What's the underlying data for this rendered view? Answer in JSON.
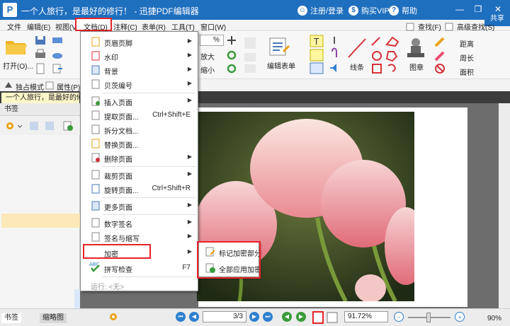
{
  "title": {
    "tagline": "一个人旅行，是最好的修行！",
    "sep": "-",
    "app": "迅捷PDF编辑器",
    "login": "注册/登录",
    "vip": "购买VIP",
    "help": "帮助",
    "logo": "P"
  },
  "menubar": {
    "items": [
      "文件",
      "编辑(E)",
      "视图(V)",
      "文档(D)",
      "注释(C)",
      "表单(R)",
      "工具(T)",
      "窗口(W)"
    ],
    "right_tab": "共享"
  },
  "toolbar": {
    "open": "打开(O)...",
    "zoom_value": "%",
    "zoom_in": "放大",
    "zoom_out": "缩小",
    "edit_form": "编辑表单",
    "lines": "线条",
    "stamp": "图章",
    "find": "查找(F)",
    "adv_find": "高级查找(S)",
    "distance": "距离",
    "perimeter": "周长",
    "area": "面积"
  },
  "subbar": {
    "exclusive": "独占模式",
    "properties": "属性(P)..."
  },
  "doc_tab": {
    "label": "一个人旅行，是最好的修行"
  },
  "panel": {
    "title": "书签"
  },
  "dropdown": {
    "items": [
      {
        "label": "页眉页脚",
        "shortcut": "",
        "submenu": true
      },
      {
        "label": "水印",
        "shortcut": "",
        "submenu": true
      },
      {
        "label": "背景",
        "shortcut": "",
        "submenu": true
      },
      {
        "label": "贝茨编号",
        "shortcut": "",
        "submenu": true
      },
      {
        "label": "插入页面",
        "shortcut": "",
        "submenu": true
      },
      {
        "label": "提取页面...",
        "shortcut": "Ctrl+Shift+E",
        "submenu": false
      },
      {
        "label": "拆分文档...",
        "shortcut": "",
        "submenu": false
      },
      {
        "label": "替换页面...",
        "shortcut": "",
        "submenu": false
      },
      {
        "label": "删除页面",
        "shortcut": "",
        "submenu": true
      },
      {
        "label": "裁剪页面",
        "shortcut": "",
        "submenu": true
      },
      {
        "label": "旋转页面...",
        "shortcut": "Ctrl+Shift+R",
        "submenu": false
      },
      {
        "label": "更多页面",
        "shortcut": "",
        "submenu": true
      },
      {
        "label": "数字签名",
        "shortcut": "",
        "submenu": true
      },
      {
        "label": "签名与缩写",
        "shortcut": "",
        "submenu": true
      },
      {
        "label": "加密",
        "shortcut": "",
        "submenu": true
      },
      {
        "label": "拼写检查",
        "shortcut": "F7",
        "submenu": false
      },
      {
        "label": "运行: <无>",
        "shortcut": "",
        "submenu": false
      }
    ],
    "abc": "ABC"
  },
  "submenu": {
    "items": [
      "标记加密部分",
      "全部应用加密"
    ]
  },
  "statusbar": {
    "tab_bookmarks": "书签",
    "tab_thumbs": "缩略图",
    "page": "3/3",
    "zoom": "91.72%",
    "right_zoom": "90%"
  },
  "colors": {
    "title_bg": "#1f6fbf",
    "highlight_red": "#e8232a",
    "menu_hover": "#fbe9b7"
  }
}
